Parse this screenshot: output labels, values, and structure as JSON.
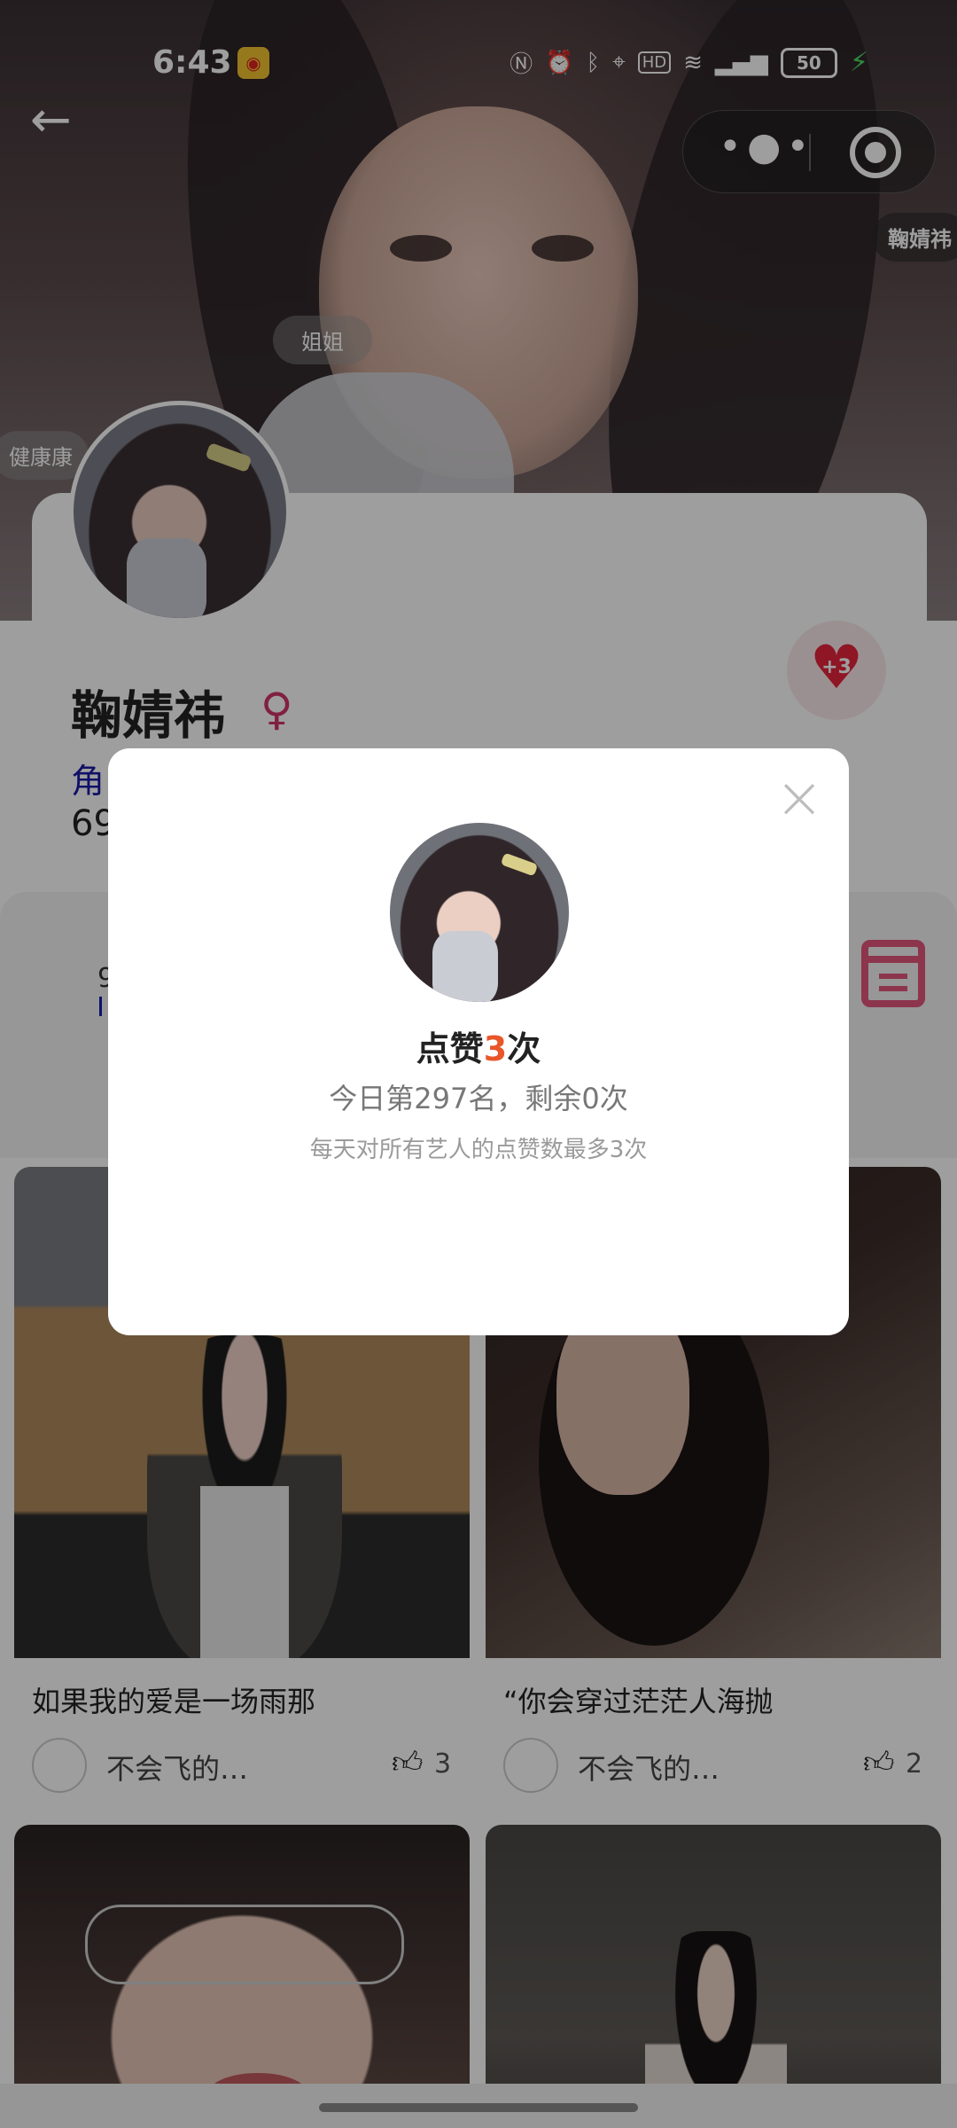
{
  "status_bar": {
    "time": "6:43",
    "battery": "50",
    "icons": [
      "nfc-icon",
      "alarm-icon",
      "bluetooth-icon",
      "location-icon",
      "hd-icon",
      "wifi-icon",
      "signal-4g-icon",
      "battery-icon",
      "charging-icon"
    ]
  },
  "nav": {
    "back_icon": "arrow-left-icon",
    "more_icon": "more-dots-icon",
    "close_icon": "target-circle-icon"
  },
  "danmaku": [
    "鞠婧祎",
    "姐姐",
    "健康康"
  ],
  "profile": {
    "name": "鞠婧祎",
    "role_text": "角",
    "count_text": "69",
    "like_badge": "+3",
    "gender_icon": "female-icon"
  },
  "section2": {
    "stub_text": "9",
    "calendar_icon": "calendar-icon"
  },
  "posts": [
    {
      "title": "如果我的爱是一场雨那",
      "author": "不会飞的…",
      "likes": "3"
    },
    {
      "title": "“你会穿过茫茫人海抛",
      "author": "不会飞的…",
      "likes": "2"
    }
  ],
  "modal": {
    "title_prefix": "点赞",
    "title_count": "3",
    "title_suffix": "次",
    "rank_text": "今日第297名，剩余0次",
    "note_text": "每天对所有艺人的点赞数最多3次",
    "close_icon": "close-x-icon"
  },
  "colors": {
    "accent_red": "#e5253d",
    "count_orange": "#e8562a",
    "calendar_pink": "#e4567c",
    "role_blue": "#1a1aa8"
  }
}
